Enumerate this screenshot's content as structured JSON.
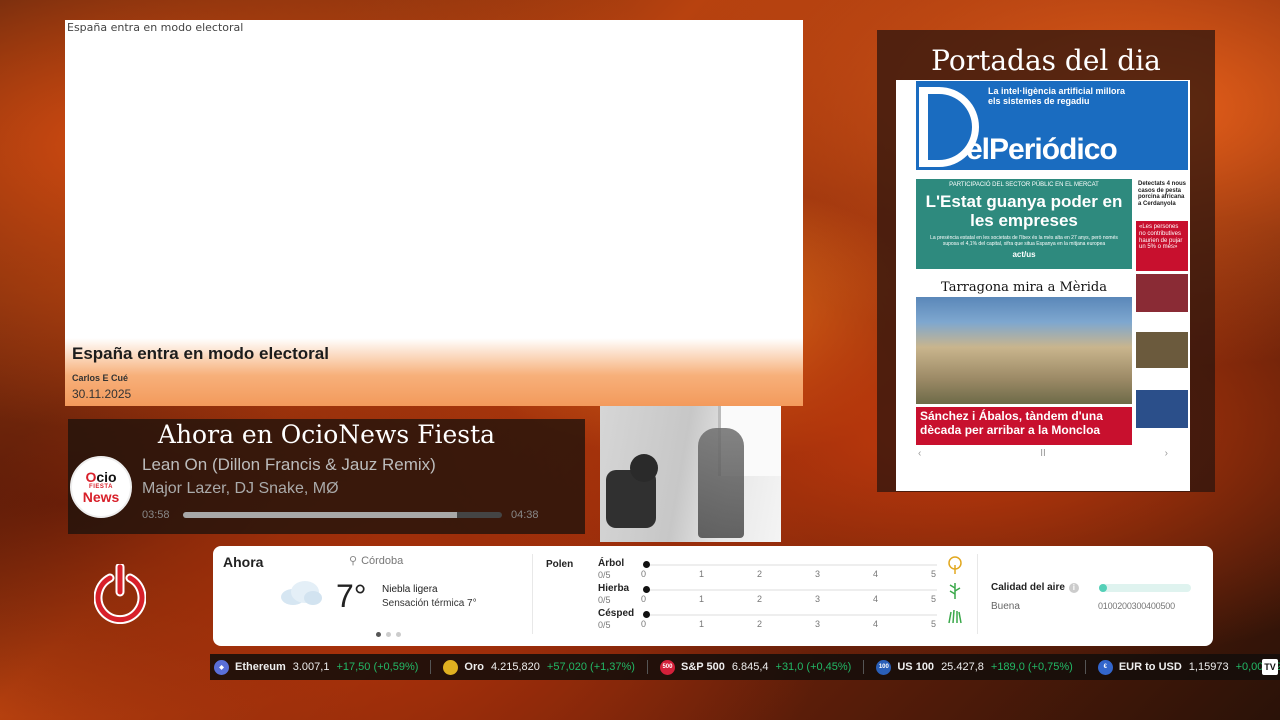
{
  "article": {
    "image_alt": "España entra en modo electoral",
    "headline": "España entra en modo electoral",
    "author": "Carlos E Cué",
    "date": "30.11.2025"
  },
  "player": {
    "heading": "Ahora en OcioNews Fiesta",
    "logo": {
      "line1a": "O",
      "line1b": "cio",
      "line2": "FIESTA",
      "line3": "News"
    },
    "song": "Lean On (Dillon Francis & Jauz Remix)",
    "artist": "Major Lazer, DJ Snake, MØ",
    "time_current": "03:58",
    "time_total": "04:38",
    "progress": 0.86
  },
  "covers": {
    "title": "Portadas del dia",
    "paper": {
      "brand": "elPeriódico",
      "teaser": "La intel·ligència artificial millora els sistemes de regadiu",
      "lead_kicker": "PARTICIPACIÓ DEL SECTOR PÚBLIC EN EL MERCAT",
      "lead_headline": "L'Estat guanya poder en les empreses",
      "lead_sub": "La presència estatal en les societats de l'Ibex és la més alta en 27 anys, però només suposa el 4,1% del capital, xifra que situa Espanya en la mitjana europea",
      "lead_logo": "act/us",
      "side_text": "Detectats 4 nous casos de pesta porcina africana a Cerdanyola",
      "side_red": "«Les persones no contributives haurien de pujar un 5% o més»",
      "photo_headline": "Tarragona mira a Mèrida",
      "red_headline": "Sánchez i Ábalos, tàndem d'una dècada per arribar a la Moncloa",
      "nav_prev": "‹",
      "nav_pause": "II",
      "nav_next": "›"
    }
  },
  "weather": {
    "now_label": "Ahora",
    "location": "Córdoba",
    "temperature": "7°",
    "condition": "Niebla ligera",
    "feels_like": "Sensación térmica 7°",
    "pollen_title": "Polen",
    "pollen": [
      {
        "name": "Árbol",
        "score": "0/5",
        "value": 0,
        "icon": "tree-icon"
      },
      {
        "name": "Hierba",
        "score": "0/5",
        "value": 0,
        "icon": "weed-icon"
      },
      {
        "name": "Césped",
        "score": "0/5",
        "value": 0,
        "icon": "grass-icon"
      }
    ],
    "pollen_ticks": [
      "0",
      "1",
      "2",
      "3",
      "4",
      "5"
    ],
    "air_title": "Calidad del aire",
    "air_value": "Buena",
    "air_scale": "0100200300400500"
  },
  "ticker": [
    {
      "name": "Ethereum",
      "price": "3.007,1",
      "change": "+17,50 (+0,59%)",
      "icon_text": "◆",
      "icon_color": "#5a6fd8"
    },
    {
      "name": "Oro",
      "price": "4.215,820",
      "change": "+57,020 (+1,37%)",
      "icon_text": "",
      "icon_color": "#e0b020"
    },
    {
      "name": "S&P 500",
      "price": "6.845,4",
      "change": "+31,0 (+0,45%)",
      "icon_text": "500",
      "icon_color": "#d3203a"
    },
    {
      "name": "US 100",
      "price": "25.427,8",
      "change": "+189,0 (+0,75%)",
      "icon_text": "100",
      "icon_color": "#2a5fb8"
    },
    {
      "name": "EUR to USD",
      "price": "1,15973",
      "change": "+0,00032 (+0,0",
      "icon_text": "€",
      "icon_color": "#3366cc"
    }
  ],
  "ticker_logo": "TV",
  "colors": {
    "change_positive": "#22b866",
    "power_red": "#d8202a",
    "paper_blue": "#1a6cc0",
    "paper_teal": "#2e8a7e"
  }
}
